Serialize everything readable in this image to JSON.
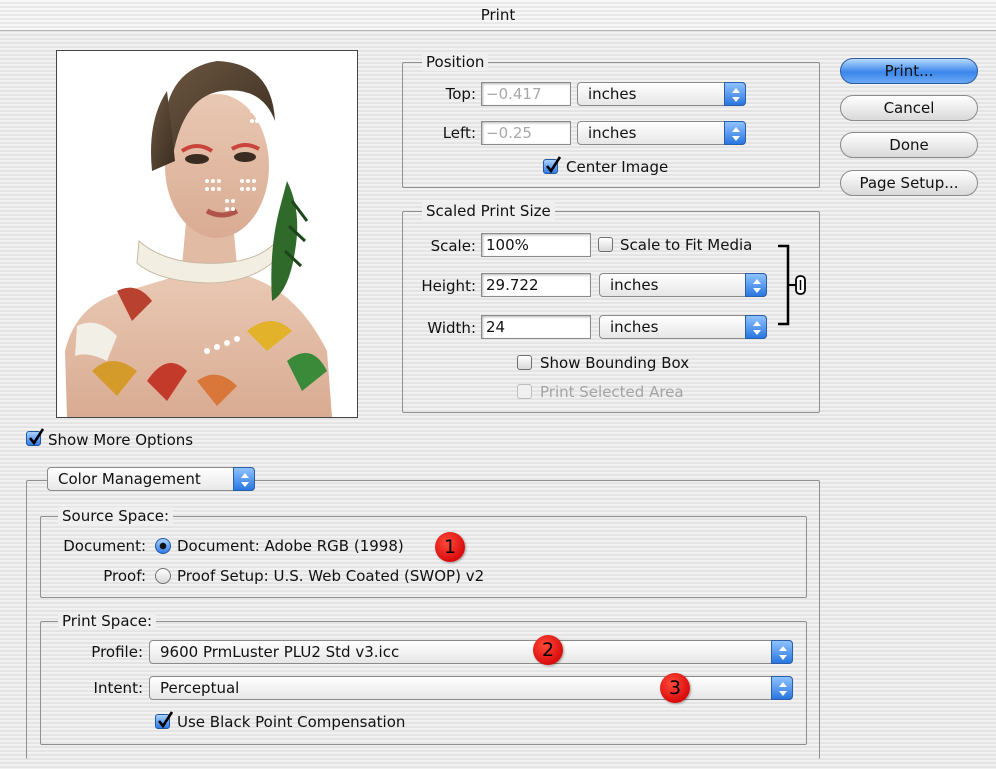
{
  "window": {
    "title": "Print"
  },
  "buttons": {
    "print": "Print...",
    "cancel": "Cancel",
    "done": "Done",
    "page_setup": "Page Setup..."
  },
  "position": {
    "legend": "Position",
    "top_label": "Top:",
    "top_value": "−0.417",
    "top_unit": "inches",
    "left_label": "Left:",
    "left_value": "−0.25",
    "left_unit": "inches",
    "center_image_label": "Center Image",
    "center_image_checked": true
  },
  "scaled": {
    "legend": "Scaled Print Size",
    "scale_label": "Scale:",
    "scale_value": "100%",
    "fit_media_label": "Scale to Fit Media",
    "fit_media_checked": false,
    "height_label": "Height:",
    "height_value": "29.722",
    "height_unit": "inches",
    "width_label": "Width:",
    "width_value": "24",
    "width_unit": "inches",
    "bounding_box_label": "Show Bounding Box",
    "bounding_box_checked": false,
    "selected_area_label": "Print Selected Area",
    "selected_area_checked": false
  },
  "more_options": {
    "label": "Show More Options",
    "checked": true,
    "section_popup": "Color Management"
  },
  "source_space": {
    "legend": "Source Space:",
    "document_label": "Document:",
    "document_option": "Document:  Adobe RGB (1998)",
    "document_selected": true,
    "proof_label": "Proof:",
    "proof_option": "Proof Setup:  U.S. Web Coated (SWOP) v2",
    "proof_selected": false
  },
  "print_space": {
    "legend": "Print Space:",
    "profile_label": "Profile:",
    "profile_value": "9600 PrmLuster PLU2 Std v3.icc",
    "intent_label": "Intent:",
    "intent_value": "Perceptual",
    "bpc_label": "Use Black Point Compensation",
    "bpc_checked": true
  },
  "callouts": [
    "1",
    "2",
    "3"
  ],
  "colors": {
    "accent": "#2f7be8",
    "callout": "#e01010"
  }
}
